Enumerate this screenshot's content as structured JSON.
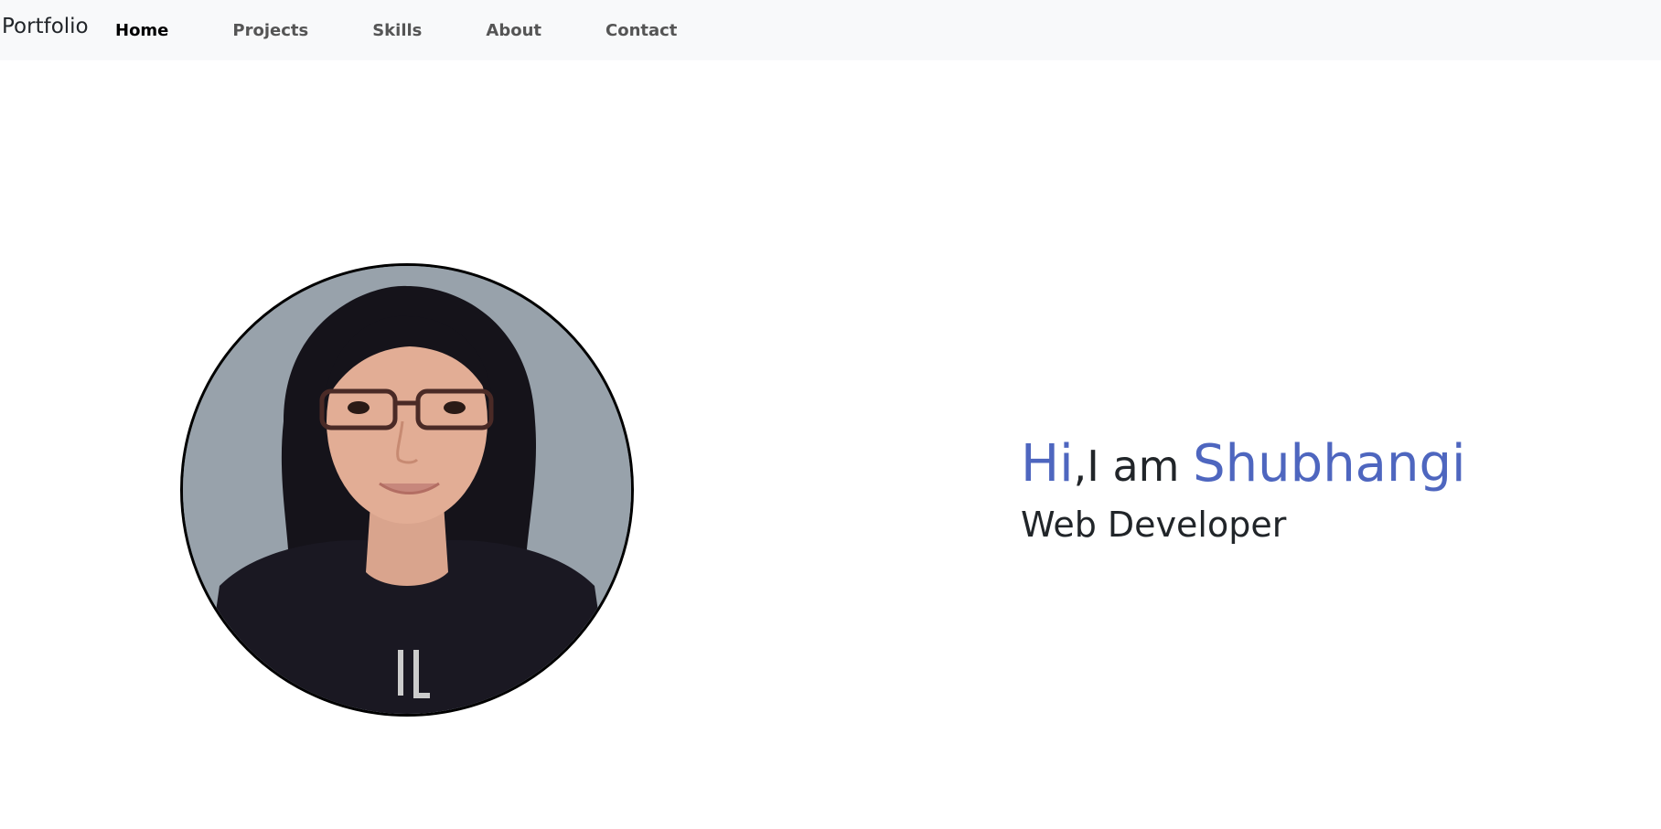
{
  "navbar": {
    "brand": "Portfolio",
    "links": [
      {
        "label": "Home",
        "active": true
      },
      {
        "label": "Projects",
        "active": false
      },
      {
        "label": "Skills",
        "active": false
      },
      {
        "label": "About",
        "active": false
      },
      {
        "label": "Contact",
        "active": false
      }
    ]
  },
  "hero": {
    "greeting_hi": "Hi",
    "greeting_mid": ",I am ",
    "name": "Shubhangi",
    "role": "Web Developer"
  },
  "colors": {
    "accent": "#4e66bf",
    "text": "#212529",
    "navbar_bg": "#f8f9fa",
    "nav_link": "#555555"
  }
}
